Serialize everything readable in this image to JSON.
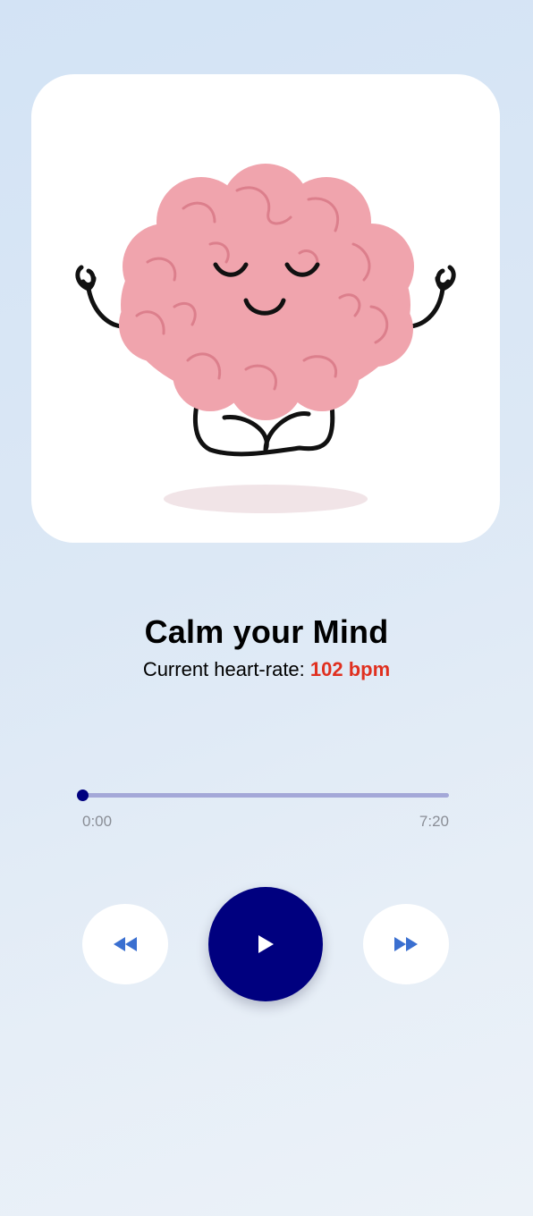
{
  "player": {
    "title": "Calm your Mind",
    "heart_rate_label": "Current heart-rate:",
    "heart_rate_value": "102 bpm",
    "elapsed": "0:00",
    "duration": "7:20",
    "progress_fraction": 0
  },
  "controls": {
    "rewind_icon": "rewind-icon",
    "play_icon": "play-icon",
    "forward_icon": "fast-forward-icon"
  },
  "colors": {
    "accent": "#00007f",
    "heart_rate": "#e03020",
    "track": "#a4a8d8",
    "icon_blue": "#3a6fd0"
  }
}
